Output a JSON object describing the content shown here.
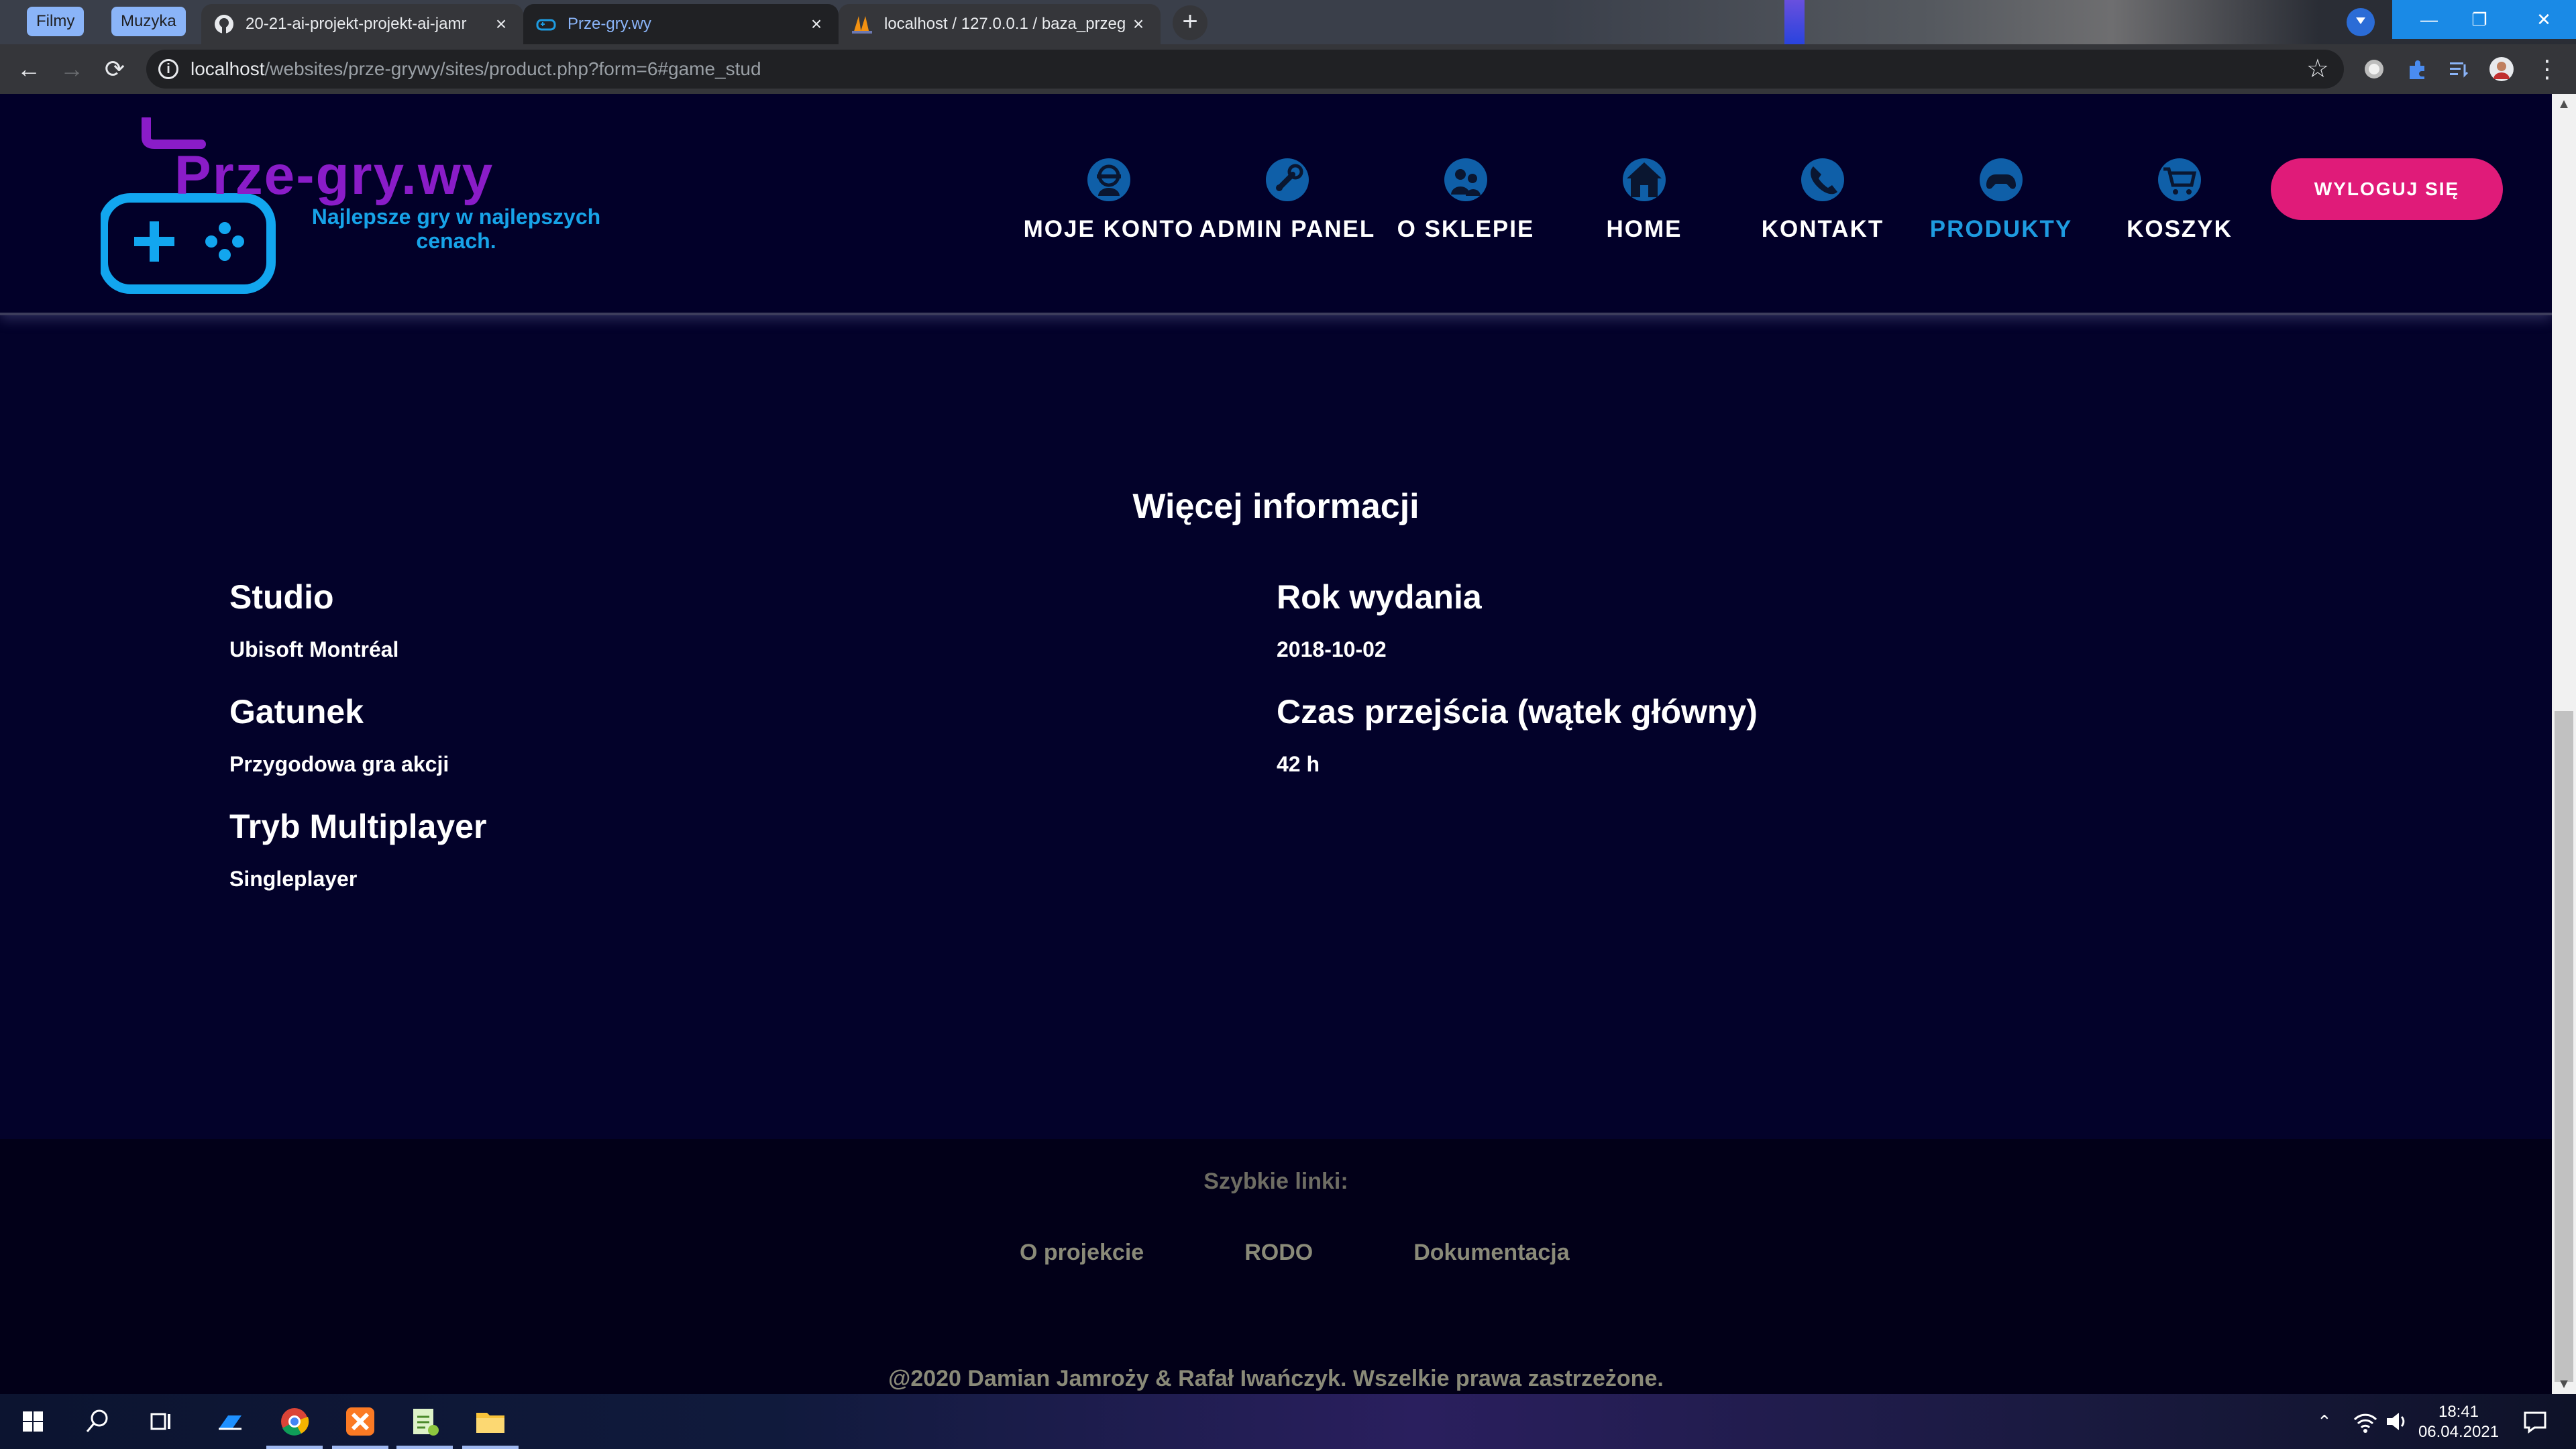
{
  "browser": {
    "tab_groups": [
      {
        "label": "Filmy"
      },
      {
        "label": "Muzyka"
      }
    ],
    "tabs": [
      {
        "title": "20-21-ai-projekt-projekt-ai-jamr",
        "icon": "github-icon"
      },
      {
        "title": "Prze-gry.wy",
        "icon": "gamepad-icon"
      },
      {
        "title": "localhost / 127.0.0.1 / baza_przeg",
        "icon": "phpmyadmin-icon"
      }
    ],
    "url_host": "localhost",
    "url_path": "/websites/prze-grywy/sites/product.php?form=6#game_stud"
  },
  "site": {
    "logo_text": "Prze-gry.wy",
    "tagline": "Najlepsze gry w najlepszych cenach.",
    "nav": [
      {
        "label": "MOJE KONTO",
        "icon": "account-icon",
        "active": false
      },
      {
        "label": "ADMIN PANEL",
        "icon": "admin-icon",
        "active": false
      },
      {
        "label": "O SKLEPIE",
        "icon": "about-icon",
        "active": false
      },
      {
        "label": "HOME",
        "icon": "home-icon",
        "active": false
      },
      {
        "label": "KONTAKT",
        "icon": "phone-icon",
        "active": false
      },
      {
        "label": "PRODUKTY",
        "icon": "controller-icon",
        "active": true
      },
      {
        "label": "KOSZYK",
        "icon": "cart-icon",
        "active": false
      }
    ],
    "logout_label": "WYLOGUJ SIĘ",
    "accent_color": "#e01b79",
    "active_color": "#1e9be0"
  },
  "details": {
    "title": "Więcej informacji",
    "left": [
      {
        "label": "Studio",
        "value": "Ubisoft Montréal"
      },
      {
        "label": "Gatunek",
        "value": "Przygodowa gra akcji"
      },
      {
        "label": "Tryb Multiplayer",
        "value": "Singleplayer"
      }
    ],
    "right": [
      {
        "label": "Rok wydania",
        "value": "2018-10-02"
      },
      {
        "label": "Czas przejścia (wątek główny)",
        "value": "42 h"
      }
    ]
  },
  "footer": {
    "title": "Szybkie linki:",
    "links": [
      "O projekcie",
      "RODO",
      "Dokumentacja"
    ],
    "copyright": "@2020 Damian Jamroży & Rafał Iwańczyk. Wszelkie prawa zastrzeżone."
  },
  "taskbar": {
    "time": "18:41",
    "date": "06.04.2021"
  }
}
